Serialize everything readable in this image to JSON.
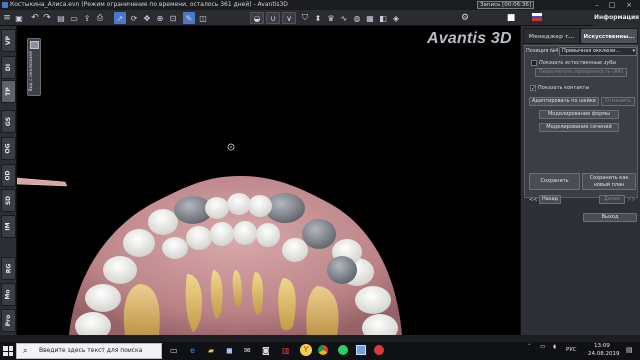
{
  "window": {
    "title": "Костыкина_Алиса.evn (Режим ограничение по времени, осталось 361 дней) - Avantis3D",
    "recording": "Запись [00:06:36]"
  },
  "right_header": {
    "tab": "Информация"
  },
  "left_tabs": [
    "VP",
    "DI",
    "TP",
    "GS",
    "OG",
    "OD",
    "SD",
    "IM",
    "RG",
    "Mo",
    "Pro"
  ],
  "viewport": {
    "view_box_label": "Вид с окклюзией",
    "logo": "Avantis 3D"
  },
  "panel": {
    "tabs": [
      "Менеджер т...",
      "Искусственны..."
    ],
    "position_label": "Позиция №4",
    "position_value": "Привычная окклюзи...",
    "show_natural_teeth": "Показать естественные зубы",
    "recalc_button": "Пересчитать прозрачность (AR)",
    "show_contacts": "Показать контакты",
    "adapt_button": "Адаптировать по шейке",
    "undo_button": "Отменить",
    "modeling_shape_button": "Моделирование формы",
    "modeling_cuts_button": "Моделирование сечений",
    "save_button": "Сохранить",
    "save_new_button": "Сохранить как новый план",
    "back_arrows": "<<",
    "back_button": "Назад",
    "next_button": "Далее",
    "next_arrows": ">>",
    "exit_button": "Выход"
  },
  "taskbar": {
    "search_placeholder": "Введите здесь текст для поиска",
    "language": "РУС",
    "time": "13:09",
    "date": "24.08.2019"
  },
  "colors": {
    "accent": "#4b78c8",
    "panel": "#2e3035",
    "gum": "#c98f94",
    "teeth": "#f1f0ec",
    "implants": "#8b8f96",
    "roots": "#d8b769"
  }
}
